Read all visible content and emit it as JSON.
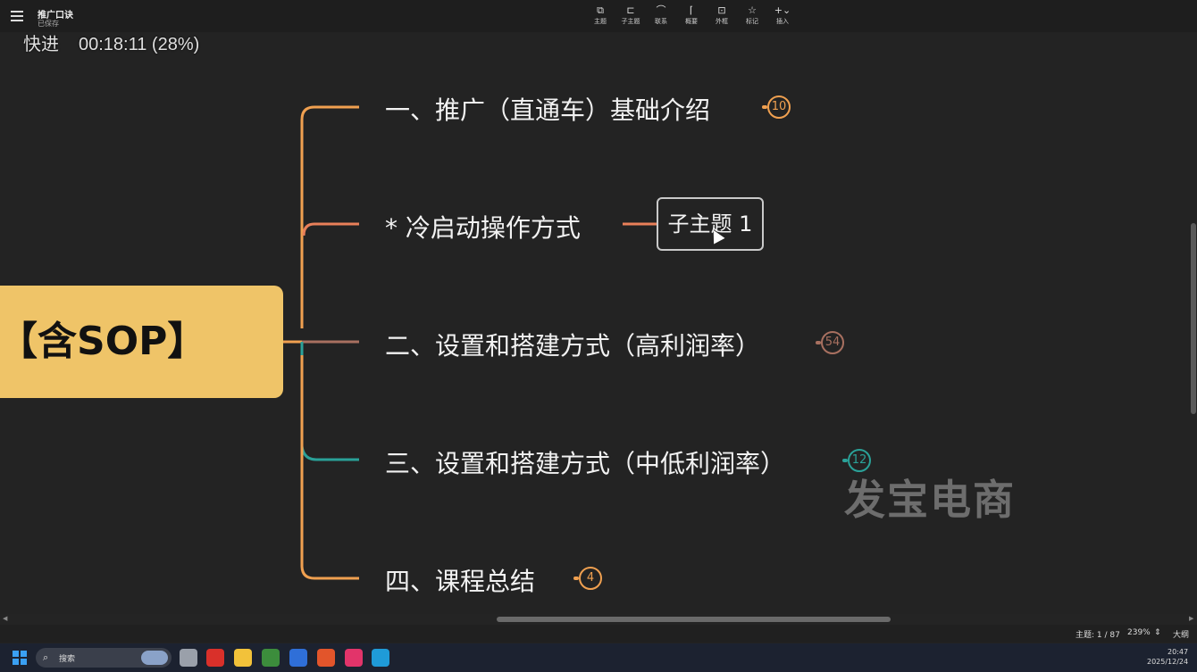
{
  "header": {
    "doc_title": "推广口诀",
    "doc_status": "已保存",
    "toolbar": [
      {
        "icon": "topic-icon",
        "glyph": "⧉",
        "label": "主题"
      },
      {
        "icon": "subtopic-icon",
        "glyph": "⊏",
        "label": "子主题"
      },
      {
        "icon": "relation-icon",
        "glyph": "⌒",
        "label": "联系"
      },
      {
        "icon": "summary-icon",
        "glyph": "⌈",
        "label": "概要"
      },
      {
        "icon": "boundary-icon",
        "glyph": "⊡",
        "label": "外框"
      },
      {
        "icon": "marker-icon",
        "glyph": "☆",
        "label": "标记"
      },
      {
        "icon": "insert-icon",
        "glyph": "+⌄",
        "label": "插入"
      }
    ]
  },
  "playback": {
    "speed_label": "快进",
    "progress_text": "00:18:11 (28%)"
  },
  "mindmap": {
    "root": "【含SOP】",
    "branches": [
      {
        "label": "一、推广（直通车）基础介绍",
        "count": "10",
        "color": "#f0a050"
      },
      {
        "label": "* 冷启动操作方式",
        "count": "",
        "color": "#e8805a"
      },
      {
        "label": "二、设置和搭建方式（高利润率）",
        "count": "54",
        "color": "#a87060"
      },
      {
        "label": "三、设置和搭建方式（中低利润率）",
        "count": "12",
        "color": "#2aa198"
      },
      {
        "label": "四、课程总结",
        "count": "4",
        "color": "#f0a050"
      }
    ],
    "subtopic": "子主题 1",
    "watermark": "发宝电商"
  },
  "statusbar": {
    "topic_count": "主题: 1 / 87",
    "zoom": "239%",
    "outline": "大纲"
  },
  "taskbar": {
    "search_placeholder": "搜索",
    "apps": [
      {
        "icon": "task-view-icon",
        "color": "#9aa0aa"
      },
      {
        "icon": "wps-icon",
        "color": "#d9302a"
      },
      {
        "icon": "file-explorer-icon",
        "color": "#f2c23a"
      },
      {
        "icon": "chrome-icon",
        "color": "#3c8d3c"
      },
      {
        "icon": "app-blue-icon",
        "color": "#2f6fd8"
      },
      {
        "icon": "app-orange-icon",
        "color": "#e2552b"
      },
      {
        "icon": "app-pink-icon",
        "color": "#e2346a"
      },
      {
        "icon": "edge-icon",
        "color": "#1f9bd8"
      }
    ],
    "time": "20:47",
    "date": "2025/12/24"
  }
}
